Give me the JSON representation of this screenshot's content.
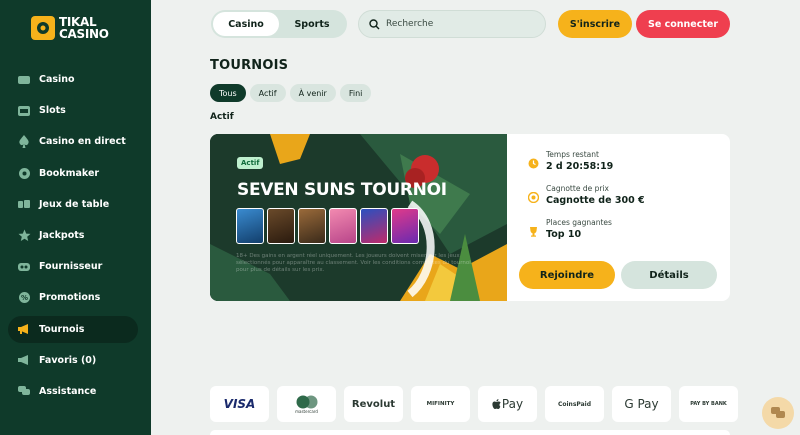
{
  "brand": {
    "line1": "TIKAL",
    "line2": "CASINO"
  },
  "sidebar": {
    "items": [
      {
        "label": "Casino",
        "icon": "casino-icon",
        "active": false
      },
      {
        "label": "Slots",
        "icon": "slots-icon",
        "active": false
      },
      {
        "label": "Casino en direct",
        "icon": "spade-icon",
        "active": false
      },
      {
        "label": "Bookmaker",
        "icon": "football-icon",
        "active": false
      },
      {
        "label": "Jeux de table",
        "icon": "table-games-icon",
        "active": false
      },
      {
        "label": "Jackpots",
        "icon": "star-icon",
        "active": false
      },
      {
        "label": "Fournisseur",
        "icon": "provider-icon",
        "active": false
      },
      {
        "label": "Promotions",
        "icon": "promotions-icon",
        "active": false
      },
      {
        "label": "Tournois",
        "icon": "megaphone-icon",
        "active": true
      },
      {
        "label": "Favoris (0)",
        "icon": "favorites-icon",
        "active": false
      },
      {
        "label": "Assistance",
        "icon": "chat-icon",
        "active": false
      }
    ]
  },
  "header": {
    "tabs": [
      "Casino",
      "Sports"
    ],
    "search_placeholder": "Recherche",
    "signup_label": "S'inscrire",
    "login_label": "Se connecter"
  },
  "page": {
    "title": "TOURNOIS",
    "filters": [
      "Tous",
      "Actif",
      "À venir",
      "Fini"
    ],
    "active_filter": "Tous",
    "section_title": "Actif"
  },
  "tournament": {
    "badge": "Actif",
    "name": "SEVEN SUNS TOURNOI",
    "description": "18+ Des gains en argent réel uniquement. Les joueurs doivent miser sur les jeux sélectionnés pour apparaître au classement. Voir les conditions complètes du tournoi pour plus de détails sur les prix.",
    "time_label": "Temps restant",
    "time_value": "2 d 20:58:19",
    "prize_label": "Cagnotte de prix",
    "prize_value": "Cagnotte de 300 €",
    "places_label": "Places gagnantes",
    "places_value": "Top 10",
    "join_label": "Rejoindre",
    "details_label": "Détails"
  },
  "payments": [
    "VISA",
    "mastercard",
    "Revolut",
    "MIFINITY",
    "Pay",
    "CoinsPaid",
    "G Pay",
    "PAY BY BANK"
  ],
  "colors": {
    "sidebar": "#0f3a2a",
    "accent": "#f6b21b",
    "danger": "#ef3f4f"
  }
}
